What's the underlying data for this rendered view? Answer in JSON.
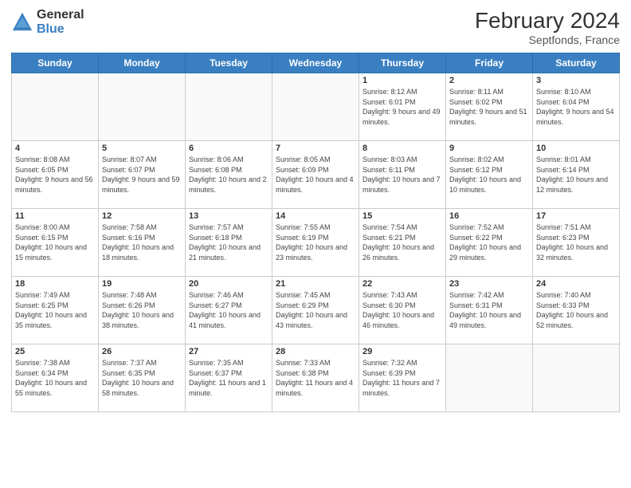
{
  "header": {
    "logo_general": "General",
    "logo_blue": "Blue",
    "month_year": "February 2024",
    "location": "Septfonds, France"
  },
  "days_of_week": [
    "Sunday",
    "Monday",
    "Tuesday",
    "Wednesday",
    "Thursday",
    "Friday",
    "Saturday"
  ],
  "weeks": [
    [
      {
        "day": "",
        "info": ""
      },
      {
        "day": "",
        "info": ""
      },
      {
        "day": "",
        "info": ""
      },
      {
        "day": "",
        "info": ""
      },
      {
        "day": "1",
        "info": "Sunrise: 8:12 AM\nSunset: 6:01 PM\nDaylight: 9 hours and 49 minutes."
      },
      {
        "day": "2",
        "info": "Sunrise: 8:11 AM\nSunset: 6:02 PM\nDaylight: 9 hours and 51 minutes."
      },
      {
        "day": "3",
        "info": "Sunrise: 8:10 AM\nSunset: 6:04 PM\nDaylight: 9 hours and 54 minutes."
      }
    ],
    [
      {
        "day": "4",
        "info": "Sunrise: 8:08 AM\nSunset: 6:05 PM\nDaylight: 9 hours and 56 minutes."
      },
      {
        "day": "5",
        "info": "Sunrise: 8:07 AM\nSunset: 6:07 PM\nDaylight: 9 hours and 59 minutes."
      },
      {
        "day": "6",
        "info": "Sunrise: 8:06 AM\nSunset: 6:08 PM\nDaylight: 10 hours and 2 minutes."
      },
      {
        "day": "7",
        "info": "Sunrise: 8:05 AM\nSunset: 6:09 PM\nDaylight: 10 hours and 4 minutes."
      },
      {
        "day": "8",
        "info": "Sunrise: 8:03 AM\nSunset: 6:11 PM\nDaylight: 10 hours and 7 minutes."
      },
      {
        "day": "9",
        "info": "Sunrise: 8:02 AM\nSunset: 6:12 PM\nDaylight: 10 hours and 10 minutes."
      },
      {
        "day": "10",
        "info": "Sunrise: 8:01 AM\nSunset: 6:14 PM\nDaylight: 10 hours and 12 minutes."
      }
    ],
    [
      {
        "day": "11",
        "info": "Sunrise: 8:00 AM\nSunset: 6:15 PM\nDaylight: 10 hours and 15 minutes."
      },
      {
        "day": "12",
        "info": "Sunrise: 7:58 AM\nSunset: 6:16 PM\nDaylight: 10 hours and 18 minutes."
      },
      {
        "day": "13",
        "info": "Sunrise: 7:57 AM\nSunset: 6:18 PM\nDaylight: 10 hours and 21 minutes."
      },
      {
        "day": "14",
        "info": "Sunrise: 7:55 AM\nSunset: 6:19 PM\nDaylight: 10 hours and 23 minutes."
      },
      {
        "day": "15",
        "info": "Sunrise: 7:54 AM\nSunset: 6:21 PM\nDaylight: 10 hours and 26 minutes."
      },
      {
        "day": "16",
        "info": "Sunrise: 7:52 AM\nSunset: 6:22 PM\nDaylight: 10 hours and 29 minutes."
      },
      {
        "day": "17",
        "info": "Sunrise: 7:51 AM\nSunset: 6:23 PM\nDaylight: 10 hours and 32 minutes."
      }
    ],
    [
      {
        "day": "18",
        "info": "Sunrise: 7:49 AM\nSunset: 6:25 PM\nDaylight: 10 hours and 35 minutes."
      },
      {
        "day": "19",
        "info": "Sunrise: 7:48 AM\nSunset: 6:26 PM\nDaylight: 10 hours and 38 minutes."
      },
      {
        "day": "20",
        "info": "Sunrise: 7:46 AM\nSunset: 6:27 PM\nDaylight: 10 hours and 41 minutes."
      },
      {
        "day": "21",
        "info": "Sunrise: 7:45 AM\nSunset: 6:29 PM\nDaylight: 10 hours and 43 minutes."
      },
      {
        "day": "22",
        "info": "Sunrise: 7:43 AM\nSunset: 6:30 PM\nDaylight: 10 hours and 46 minutes."
      },
      {
        "day": "23",
        "info": "Sunrise: 7:42 AM\nSunset: 6:31 PM\nDaylight: 10 hours and 49 minutes."
      },
      {
        "day": "24",
        "info": "Sunrise: 7:40 AM\nSunset: 6:33 PM\nDaylight: 10 hours and 52 minutes."
      }
    ],
    [
      {
        "day": "25",
        "info": "Sunrise: 7:38 AM\nSunset: 6:34 PM\nDaylight: 10 hours and 55 minutes."
      },
      {
        "day": "26",
        "info": "Sunrise: 7:37 AM\nSunset: 6:35 PM\nDaylight: 10 hours and 58 minutes."
      },
      {
        "day": "27",
        "info": "Sunrise: 7:35 AM\nSunset: 6:37 PM\nDaylight: 11 hours and 1 minute."
      },
      {
        "day": "28",
        "info": "Sunrise: 7:33 AM\nSunset: 6:38 PM\nDaylight: 11 hours and 4 minutes."
      },
      {
        "day": "29",
        "info": "Sunrise: 7:32 AM\nSunset: 6:39 PM\nDaylight: 11 hours and 7 minutes."
      },
      {
        "day": "",
        "info": ""
      },
      {
        "day": "",
        "info": ""
      }
    ]
  ]
}
